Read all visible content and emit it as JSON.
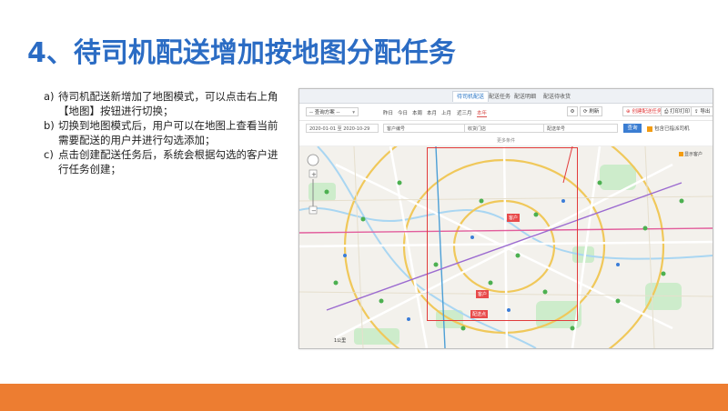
{
  "slide": {
    "title": "4、待司机配送增加按地图分配任务",
    "bullets": [
      {
        "marker": "a)",
        "text": "待司机配送新增加了地图模式，可以点击右上角【地图】按钮进行切换；"
      },
      {
        "marker": "b)",
        "text": "切换到地图模式后，用户可以在地图上查看当前需要配送的用户并进行勾选添加；"
      },
      {
        "marker": "c)",
        "text": "点击创建配送任务后，系统会根据勾选的客户进行任务创建；"
      }
    ]
  },
  "screenshot": {
    "tabs": [
      {
        "label": "待司机配送",
        "active": true
      },
      {
        "label": "配送任务",
        "active": false
      },
      {
        "label": "配送明细",
        "active": false
      },
      {
        "label": "配送待收货",
        "active": false
      }
    ],
    "toolbar": {
      "select_value": "-- 查询方案 --",
      "quick_dates": [
        {
          "label": "昨日",
          "active": false
        },
        {
          "label": "今日",
          "active": false
        },
        {
          "label": "本周",
          "active": false
        },
        {
          "label": "本月",
          "active": false
        },
        {
          "label": "上月",
          "active": false
        },
        {
          "label": "近三月",
          "active": false
        },
        {
          "label": "本年",
          "active": true
        }
      ],
      "refresh_label": "刷新",
      "map_label": "列表",
      "create_label": "创建配送任务",
      "print_label": "打印打印",
      "export_label": "导出"
    },
    "filters": {
      "date_range": "2020-01-01 至 2020-10-29",
      "customer_placeholder": "客户编号",
      "name_placeholder": "收货门店",
      "order_placeholder": "配送单号",
      "search_label": "查询",
      "include_label": "包含已指派司机"
    },
    "more_label": "更多条件",
    "map": {
      "legend_label": "显示客户",
      "pins": [
        "客户",
        "客户",
        "配送点"
      ],
      "scale_label": "1公里",
      "colors": {
        "water": "#bfe3f7",
        "park": "#c9ecc8",
        "road": "#ffffff",
        "yellow_road": "#f6d97a",
        "red": "#e23b3b",
        "bg": "#f3f1ec"
      }
    }
  }
}
